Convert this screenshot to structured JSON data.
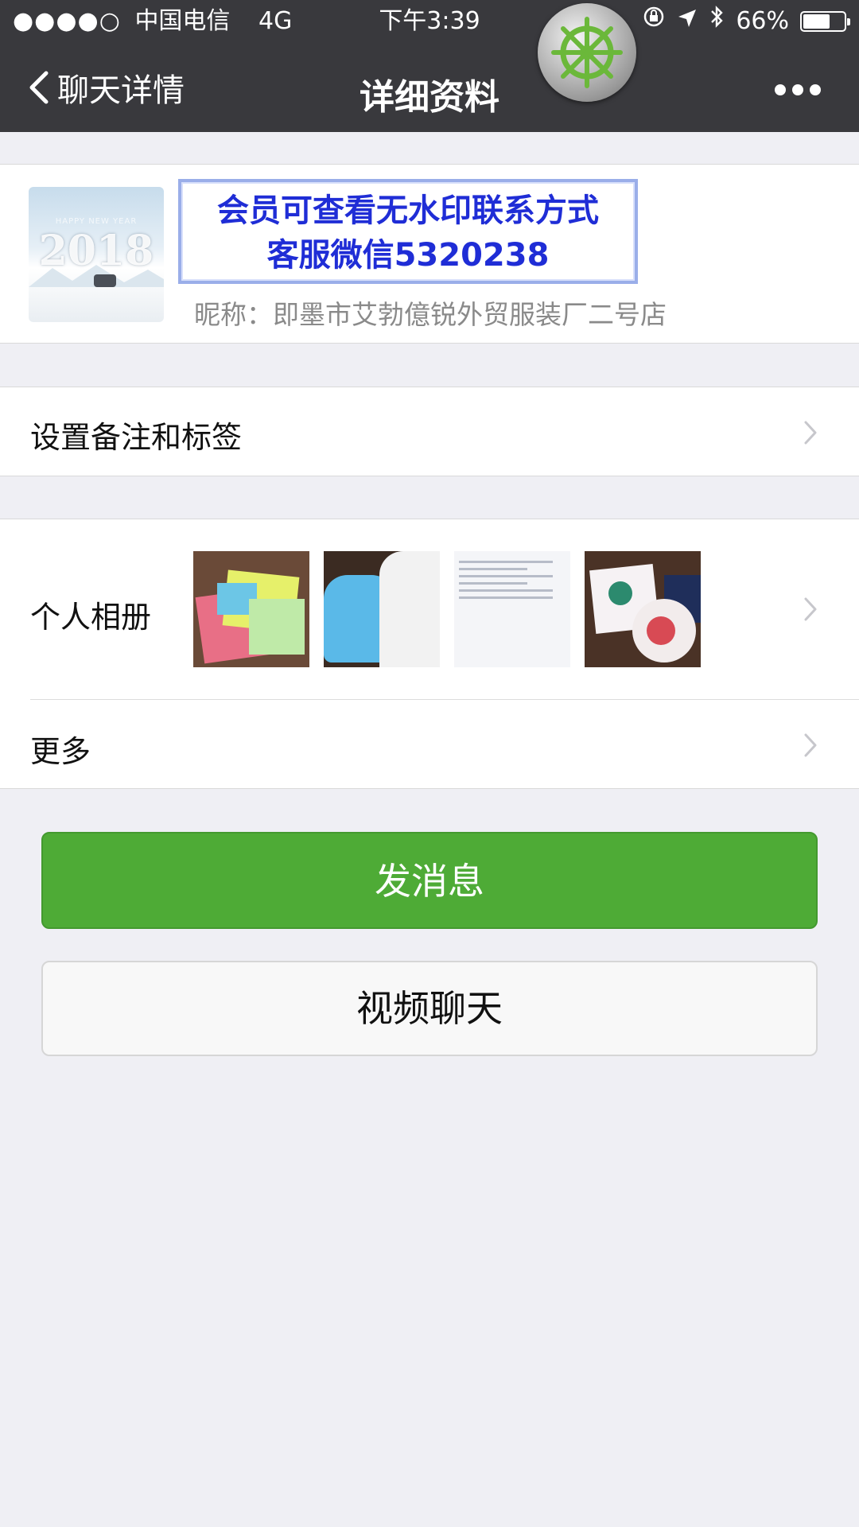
{
  "status_bar": {
    "signal": "●●●●○",
    "carrier": "中国电信",
    "network": "4G",
    "time": "下午3:39",
    "battery_percent": "66%",
    "battery_level": 0.66
  },
  "navbar": {
    "back_label": "聊天详情",
    "title": "详细资料"
  },
  "profile": {
    "avatar_text_small": "HAPPY NEW YEAR",
    "avatar_text_year": "2018",
    "banner_line1": "会员可查看无水印联系方式",
    "banner_line2": "客服微信5320238",
    "nickname": "昵称：即墨市艾勃億锐外贸服装厂二号店"
  },
  "cells": {
    "remark_label": "设置备注和标签",
    "album_label": "个人相册",
    "more_label": "更多"
  },
  "buttons": {
    "send_message": "发消息",
    "video_chat": "视频聊天"
  },
  "colors": {
    "topbar": "#39393d",
    "accent_green": "#4eab36",
    "banner_text": "#1f2dd6",
    "background": "#efeff4"
  },
  "icons": [
    "back-chevron-icon",
    "more-dots-icon",
    "ship-wheel-icon",
    "chevron-right-icon",
    "battery-icon",
    "lock-rotation-icon",
    "location-arrow-icon",
    "bluetooth-icon"
  ]
}
